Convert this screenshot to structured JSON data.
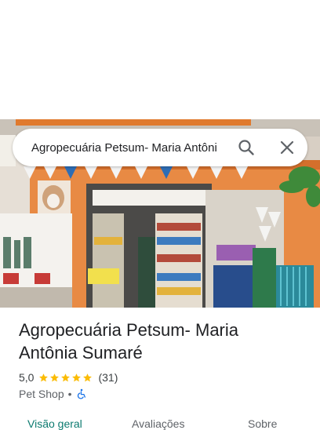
{
  "search": {
    "query": "Agropecuária Petsum- Maria Antôni",
    "search_icon": "search-icon",
    "close_icon": "close-icon"
  },
  "place": {
    "title_line1": "Agropecuária Petsum- Maria",
    "title_line2": "Antônia Sumaré",
    "rating": "5,0",
    "stars": 5,
    "review_count": "(31)",
    "category": "Pet Shop",
    "separator": "•",
    "accessibility_icon": "wheelchair-icon"
  },
  "tabs": [
    {
      "label": "Visão geral",
      "active": true
    },
    {
      "label": "Avaliações",
      "active": false
    },
    {
      "label": "Sobre",
      "active": false
    }
  ],
  "colors": {
    "accent": "#0b7a6f",
    "star": "#fbbc04",
    "accessibility": "#1a73e8"
  }
}
